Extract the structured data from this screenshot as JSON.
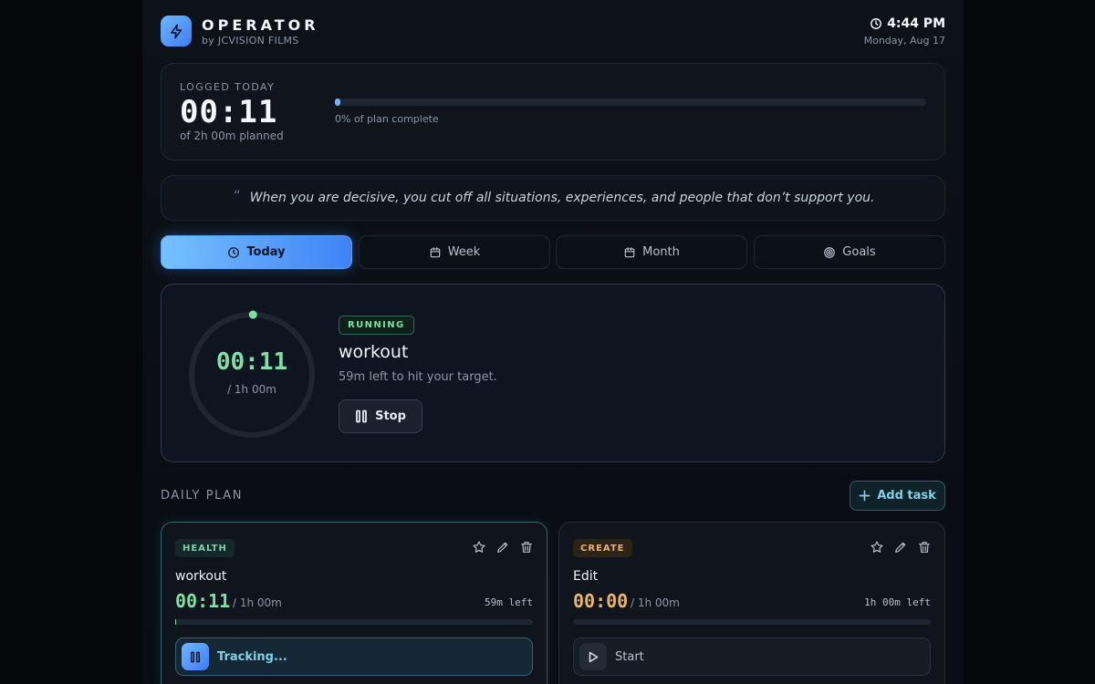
{
  "app": {
    "title": "OPERATOR",
    "subtitle": "by JCVISION FILMS",
    "time": "4:44 PM",
    "date": "Monday, Aug 17"
  },
  "logged": {
    "label": "LOGGED TODAY",
    "time": "00:11",
    "planned": "of 2h 00m planned",
    "progress_text": "0% of plan complete",
    "progress_fraction": 0.01
  },
  "quote": {
    "mark": "“",
    "text": "When you are decisive, you cut off all situations, experiences, and people that don’t support you."
  },
  "tabs": [
    {
      "label": "Today",
      "icon": "clock-icon",
      "active": true
    },
    {
      "label": "Week",
      "icon": "calendar-icon",
      "active": false
    },
    {
      "label": "Month",
      "icon": "calendar-icon",
      "active": false
    },
    {
      "label": "Goals",
      "icon": "target-icon",
      "active": false
    }
  ],
  "running": {
    "badge": "RUNNING",
    "title": "workout",
    "subtitle": "59m left to hit your target.",
    "timer": "00:11",
    "target": "/ 1h 00m",
    "progress_fraction": 0.003,
    "stop_label": "Stop"
  },
  "plan": {
    "label": "DAILY PLAN",
    "add_label": "Add task",
    "tasks": [
      {
        "tag": "HEALTH",
        "name": "workout",
        "elapsed": "00:11",
        "planned": "/ 1h 00m",
        "left": "59m left",
        "progress_fraction": 0.003,
        "button_label": "Tracking..."
      },
      {
        "tag": "CREATE",
        "name": "Edit",
        "elapsed": "00:00",
        "planned": "/ 1h 00m",
        "left": "1h 00m left",
        "progress_fraction": 0,
        "button_label": "Start"
      }
    ]
  },
  "colors": {
    "accent_blue": "#3f82f6",
    "accent_green": "#7ee0a5",
    "accent_amber": "#e7b46a",
    "accent_teal": "#7fd0e8"
  }
}
